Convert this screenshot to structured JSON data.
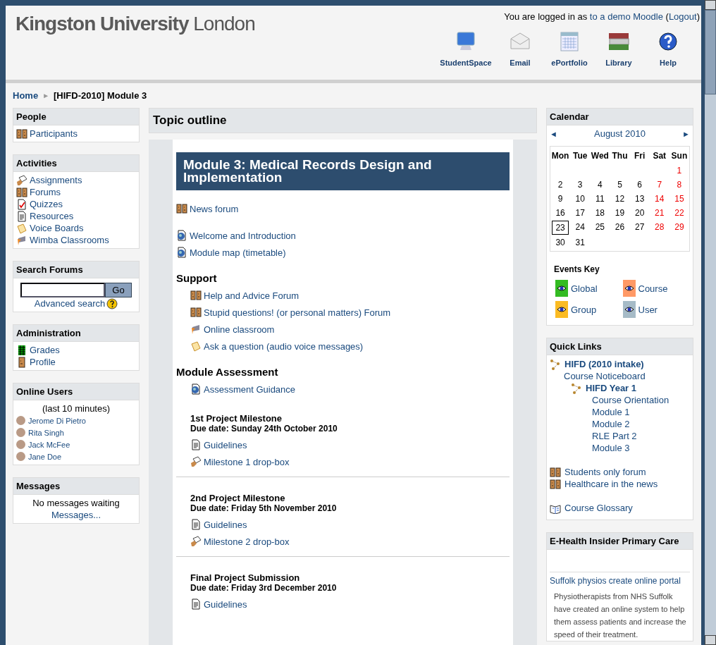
{
  "header": {
    "logo": {
      "name": "Kingston University",
      "city": "London"
    },
    "login": {
      "prefix": "You are logged in as",
      "user": "to a demo Moodle",
      "open": "(",
      "logout": "Logout",
      "close": ")"
    },
    "nav": [
      {
        "kind": "monitor",
        "label": "StudentSpace"
      },
      {
        "kind": "envelope",
        "label": "Email"
      },
      {
        "kind": "calendar",
        "label": "ePortfolio"
      },
      {
        "kind": "books",
        "label": "Library"
      },
      {
        "kind": "help",
        "label": "Help"
      }
    ]
  },
  "breadcrumb": {
    "home": "Home",
    "separator": "►",
    "current": "[HIFD-2010] Module 3"
  },
  "left_blocks": [
    {
      "kind": "links",
      "title": "People",
      "items": [
        {
          "kind": "forum",
          "label": "Participants"
        }
      ]
    },
    {
      "kind": "links",
      "title": "Activities",
      "items": [
        {
          "kind": "assignment",
          "label": "Assignments"
        },
        {
          "kind": "forum",
          "label": "Forums"
        },
        {
          "kind": "quiz",
          "label": "Quizzes"
        },
        {
          "kind": "resource",
          "label": "Resources"
        },
        {
          "kind": "voice",
          "label": "Voice Boards"
        },
        {
          "kind": "wimba",
          "label": "Wimba Classrooms"
        }
      ]
    },
    {
      "kind": "search",
      "title": "Search Forums",
      "button": "Go",
      "link": "Advanced search"
    },
    {
      "kind": "links",
      "title": "Administration",
      "items": [
        {
          "kind": "grades",
          "label": "Grades"
        },
        {
          "kind": "profile",
          "label": "Profile"
        }
      ]
    },
    {
      "kind": "users",
      "title": "Online Users",
      "note": "(last 10 minutes)",
      "users": [
        "Jerome Di Pietro",
        "Rita Singh",
        "Jack McFee",
        "Jane Doe"
      ]
    },
    {
      "kind": "messages",
      "title": "Messages",
      "note": "No messages waiting",
      "link": "Messages..."
    }
  ],
  "topic_outline": {
    "title": "Topic outline",
    "section_title": "Module 3: Medical Records Design and Implementation",
    "intro_groups": [
      [
        {
          "kind": "forum",
          "label": "News forum"
        }
      ],
      [
        {
          "kind": "web",
          "label": "Welcome and Introduction"
        },
        {
          "kind": "web",
          "label": "Module map (timetable)"
        }
      ]
    ],
    "sections": [
      {
        "title": "Support",
        "links": [
          {
            "kind": "forum",
            "label": "Help and Advice Forum"
          },
          {
            "kind": "forum",
            "label": "Stupid questions! (or personal matters) Forum"
          },
          {
            "kind": "wimba",
            "label": "Online classroom"
          },
          {
            "kind": "voice",
            "label": "Ask a question (audio voice messages)"
          }
        ]
      },
      {
        "title": "Module Assessment",
        "links": [
          {
            "kind": "web",
            "label": "Assessment Guidance"
          }
        ],
        "milestones": [
          {
            "title": "1st Project Milestone",
            "due": "Due date: Sunday 24th October 2010",
            "links": [
              {
                "kind": "resource",
                "label": "Guidelines"
              },
              {
                "kind": "assignment",
                "label": "Milestone 1 drop-box"
              }
            ]
          },
          {
            "title": "2nd Project Milestone",
            "due": "Due date: Friday 5th November 2010",
            "links": [
              {
                "kind": "resource",
                "label": "Guidelines"
              },
              {
                "kind": "assignment",
                "label": "Milestone 2 drop-box"
              }
            ]
          },
          {
            "title": "Final Project Submission",
            "due": "Due date: Friday 3rd December 2010",
            "links": [
              {
                "kind": "resource",
                "label": "Guidelines"
              }
            ]
          }
        ]
      }
    ]
  },
  "calendar": {
    "title": "Calendar",
    "prev": "◄",
    "month": "August 2010",
    "next": "►",
    "weekdays": [
      "Mon",
      "Tue",
      "Wed",
      "Thu",
      "Fri",
      "Sat",
      "Sun"
    ],
    "weeks": [
      [
        {
          "kind": "blank"
        },
        {
          "kind": "blank"
        },
        {
          "kind": "blank"
        },
        {
          "kind": "blank"
        },
        {
          "kind": "blank"
        },
        {
          "kind": "blank"
        },
        {
          "kind": "day",
          "day": "1",
          "weekend": true,
          "today": false
        }
      ],
      [
        {
          "kind": "day",
          "day": "2",
          "weekend": false,
          "today": false
        },
        {
          "kind": "day",
          "day": "3",
          "weekend": false,
          "today": false
        },
        {
          "kind": "day",
          "day": "4",
          "weekend": false,
          "today": false
        },
        {
          "kind": "day",
          "day": "5",
          "weekend": false,
          "today": false
        },
        {
          "kind": "day",
          "day": "6",
          "weekend": false,
          "today": false
        },
        {
          "kind": "day",
          "day": "7",
          "weekend": true,
          "today": false
        },
        {
          "kind": "day",
          "day": "8",
          "weekend": true,
          "today": false
        }
      ],
      [
        {
          "kind": "day",
          "day": "9",
          "weekend": false,
          "today": false
        },
        {
          "kind": "day",
          "day": "10",
          "weekend": false,
          "today": false
        },
        {
          "kind": "day",
          "day": "11",
          "weekend": false,
          "today": false
        },
        {
          "kind": "day",
          "day": "12",
          "weekend": false,
          "today": false
        },
        {
          "kind": "day",
          "day": "13",
          "weekend": false,
          "today": false
        },
        {
          "kind": "day",
          "day": "14",
          "weekend": true,
          "today": false
        },
        {
          "kind": "day",
          "day": "15",
          "weekend": true,
          "today": false
        }
      ],
      [
        {
          "kind": "day",
          "day": "16",
          "weekend": false,
          "today": false
        },
        {
          "kind": "day",
          "day": "17",
          "weekend": false,
          "today": false
        },
        {
          "kind": "day",
          "day": "18",
          "weekend": false,
          "today": false
        },
        {
          "kind": "day",
          "day": "19",
          "weekend": false,
          "today": false
        },
        {
          "kind": "day",
          "day": "20",
          "weekend": false,
          "today": false
        },
        {
          "kind": "day",
          "day": "21",
          "weekend": true,
          "today": false
        },
        {
          "kind": "day",
          "day": "22",
          "weekend": true,
          "today": false
        }
      ],
      [
        {
          "kind": "day",
          "day": "23",
          "weekend": false,
          "today": true
        },
        {
          "kind": "day",
          "day": "24",
          "weekend": false,
          "today": false
        },
        {
          "kind": "day",
          "day": "25",
          "weekend": false,
          "today": false
        },
        {
          "kind": "day",
          "day": "26",
          "weekend": false,
          "today": false
        },
        {
          "kind": "day",
          "day": "27",
          "weekend": false,
          "today": false
        },
        {
          "kind": "day",
          "day": "28",
          "weekend": true,
          "today": false
        },
        {
          "kind": "day",
          "day": "29",
          "weekend": true,
          "today": false
        }
      ],
      [
        {
          "kind": "day",
          "day": "30",
          "weekend": false,
          "today": false
        },
        {
          "kind": "day",
          "day": "31",
          "weekend": false,
          "today": false
        }
      ]
    ],
    "events_title": "Events Key",
    "events": [
      {
        "label": "Global",
        "color": "#33bb22"
      },
      {
        "label": "Course",
        "color": "#ff9966"
      },
      {
        "label": "Group",
        "color": "#fbbb23"
      },
      {
        "label": "User",
        "color": "#a6bbc7"
      }
    ]
  },
  "quick_links": {
    "title": "Quick Links",
    "tree": [
      {
        "kind": "category",
        "label": "HIFD (2010 intake)",
        "children": [
          {
            "kind": "link",
            "label": "Course Noticeboard"
          },
          {
            "kind": "category",
            "label": "HIFD Year 1",
            "children": [
              "Course Orientation",
              "Module 1",
              "Module 2",
              "RLE Part 2",
              "Module 3"
            ]
          }
        ]
      }
    ],
    "groups": [
      [
        {
          "kind": "forum",
          "label": "Students only forum"
        },
        {
          "kind": "forum",
          "label": "Healthcare in the news"
        }
      ],
      [
        {
          "kind": "glossary",
          "label": "Course Glossary"
        }
      ]
    ]
  },
  "news_feed": {
    "title": "E-Health Insider Primary Care",
    "headline": "Suffolk physios create online portal",
    "summary": "Physiotherapists from NHS Suffolk have created an online system to help them assess patients and increase the speed of their treatment."
  }
}
